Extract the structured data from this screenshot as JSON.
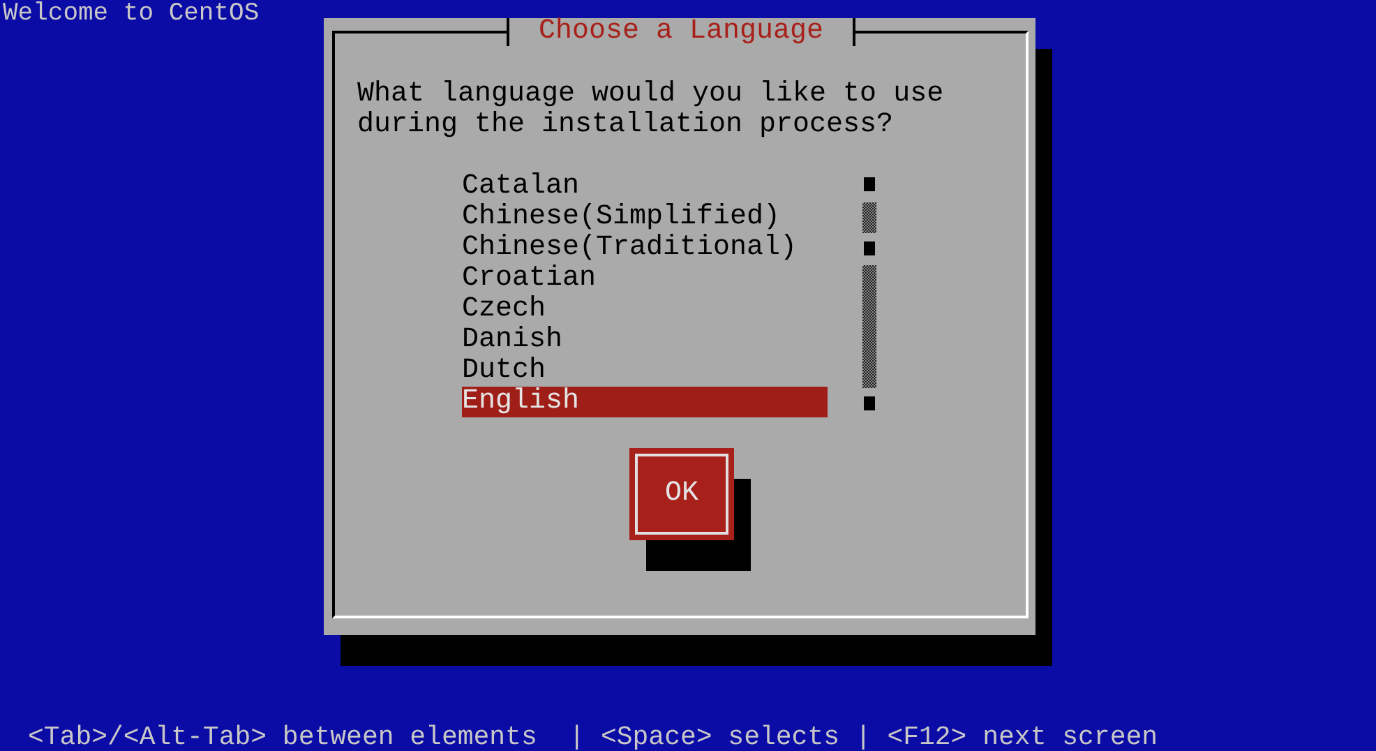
{
  "header": "Welcome to CentOS",
  "dialog": {
    "title": "Choose a Language",
    "prompt": "What language would you like to use\nduring the installation process?",
    "languages": [
      {
        "label": "Catalan",
        "selected": false
      },
      {
        "label": "Chinese(Simplified)",
        "selected": false
      },
      {
        "label": "Chinese(Traditional)",
        "selected": false
      },
      {
        "label": "Croatian",
        "selected": false
      },
      {
        "label": "Czech",
        "selected": false
      },
      {
        "label": "Danish",
        "selected": false
      },
      {
        "label": "Dutch",
        "selected": false
      },
      {
        "label": "English",
        "selected": true
      }
    ],
    "ok_button": "OK"
  },
  "footer": "<Tab>/<Alt-Tab> between elements  | <Space> selects | <F12> next screen"
}
